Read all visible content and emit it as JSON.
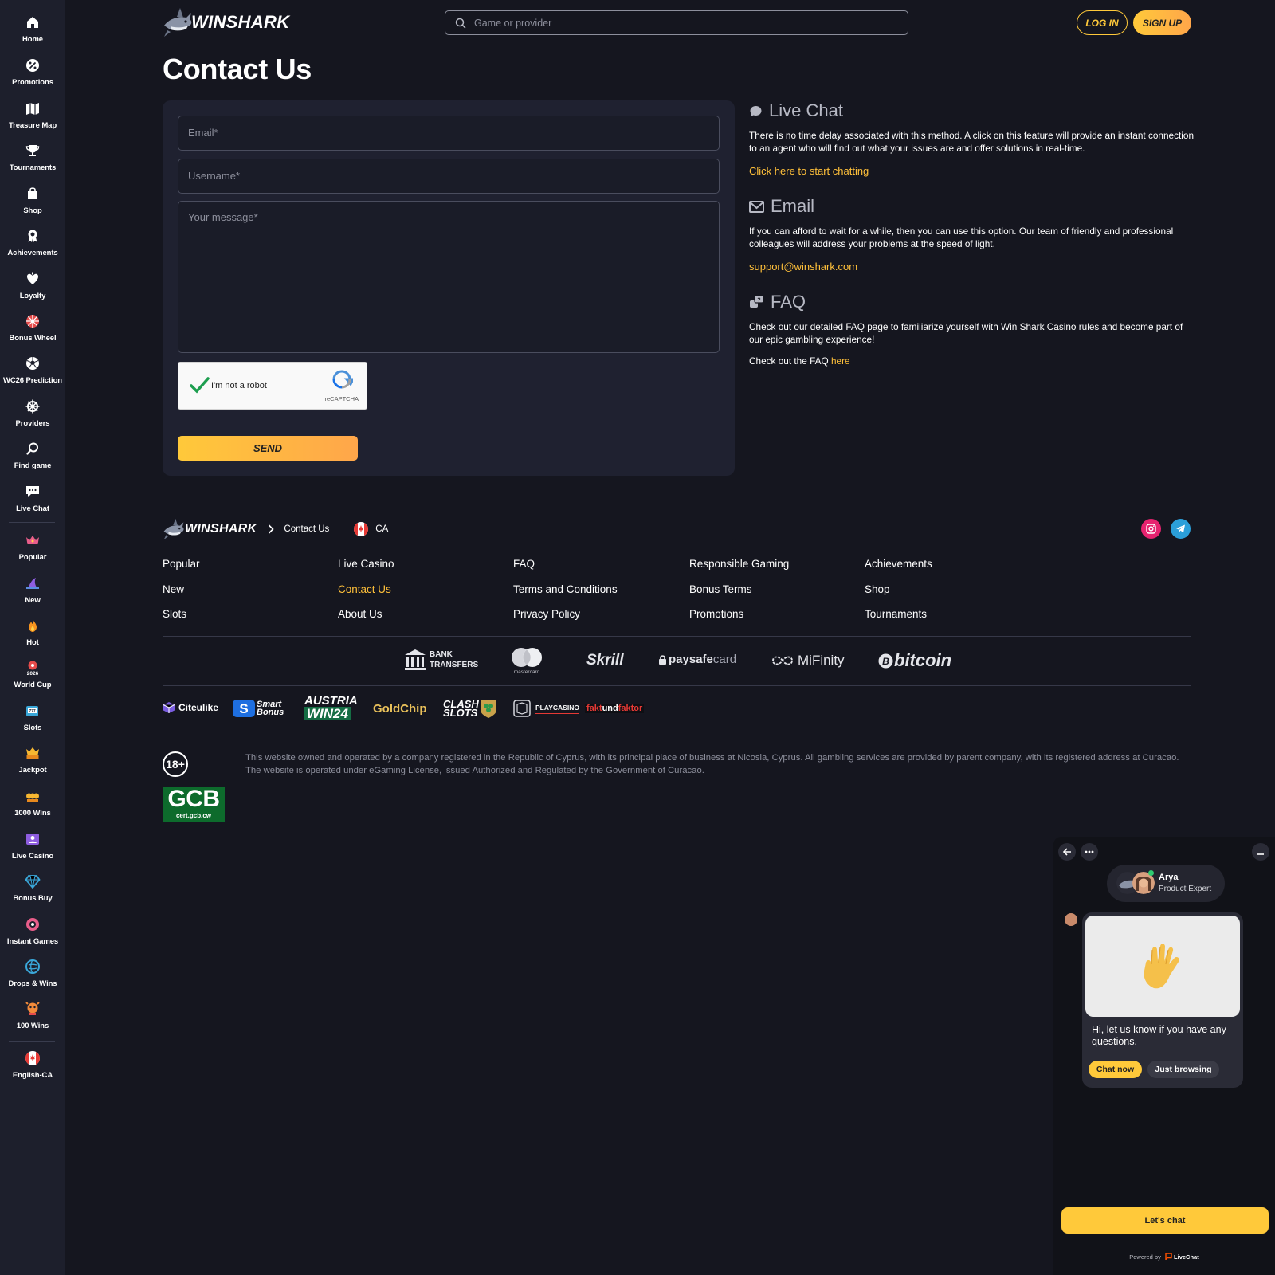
{
  "brand": {
    "name": "WINSHARK",
    "accent": "#ffc93a",
    "background": "#15161f",
    "sidebar_bg": "#1d1f2c"
  },
  "sidebar": {
    "items": [
      {
        "label": "Home",
        "icon": "home-icon"
      },
      {
        "label": "Promotions",
        "icon": "promotions-icon"
      },
      {
        "label": "Treasure Map",
        "icon": "map-icon"
      },
      {
        "label": "Tournaments",
        "icon": "trophy-icon"
      },
      {
        "label": "Shop",
        "icon": "shopping-bag-icon"
      },
      {
        "label": "Achievements",
        "icon": "medal-icon"
      },
      {
        "label": "Loyalty",
        "icon": "loyalty-icon"
      },
      {
        "label": "Bonus Wheel",
        "icon": "wheel-icon"
      },
      {
        "label": "WC26 Prediction",
        "icon": "soccer-ball-icon"
      },
      {
        "label": "Providers",
        "icon": "providers-icon"
      },
      {
        "label": "Find game",
        "icon": "search-icon"
      },
      {
        "label": "Live Chat",
        "icon": "chat-icon"
      }
    ],
    "categories": [
      {
        "label": "Popular",
        "icon": "crown-icon"
      },
      {
        "label": "New",
        "icon": "shark-fin-icon"
      },
      {
        "label": "Hot",
        "icon": "flame-icon"
      },
      {
        "label": "World Cup",
        "icon": "world-cup-icon"
      },
      {
        "label": "Slots",
        "icon": "slot-machine-icon"
      },
      {
        "label": "Jackpot",
        "icon": "jackpot-icon"
      },
      {
        "label": "1000 Wins",
        "icon": "wins-icon"
      },
      {
        "label": "Live Casino",
        "icon": "live-casino-icon"
      },
      {
        "label": "Bonus Buy",
        "icon": "diamond-icon"
      },
      {
        "label": "Instant Games",
        "icon": "instant-games-icon"
      },
      {
        "label": "Drops & Wins",
        "icon": "drops-wins-icon"
      },
      {
        "label": "100 Wins",
        "icon": "hundred-wins-icon"
      }
    ],
    "language": {
      "label": "English-CA",
      "icon": "canada-flag-icon"
    }
  },
  "header": {
    "search_placeholder": "Game or provider",
    "login_label": "LOG IN",
    "signup_label": "SIGN UP"
  },
  "page": {
    "title": "Contact Us"
  },
  "form": {
    "email_placeholder": "Email*",
    "username_placeholder": "Username*",
    "message_placeholder": "Your message*",
    "captcha_label": "I'm not a robot",
    "captcha_brand": "reCAPTCHA",
    "send_label": "SEND"
  },
  "info": {
    "live_chat": {
      "title": "Live Chat",
      "text": "There is no time delay associated with this method. A click on this feature will provide an instant connection to an agent who will find out what your issues are and offer solutions in real-time.",
      "link": "Click here to start chatting"
    },
    "email": {
      "title": "Email",
      "text": "If you can afford to wait for a while, then you can use this option. Our team of friendly and professional colleagues will address your problems at the speed of light.",
      "link": "support@winshark.com"
    },
    "faq": {
      "title": "FAQ",
      "text": "Check out our detailed FAQ page to familiarize yourself with Win Shark Casino rules and become part of our epic gambling experience!",
      "note_prefix": "Check out the FAQ",
      "note_link": "here"
    }
  },
  "footer": {
    "breadcrumb": "Contact Us",
    "country": "CA",
    "columns": [
      [
        "Popular",
        "New",
        "Slots"
      ],
      [
        "Live Casino",
        "Contact Us",
        "About Us"
      ],
      [
        "FAQ",
        "Terms and Conditions",
        "Privacy Policy"
      ],
      [
        "Responsible Gaming",
        "Bonus Terms",
        "Promotions"
      ],
      [
        "Achievements",
        "Shop",
        "Tournaments"
      ]
    ],
    "payments": {
      "bank_line1": "BANK",
      "bank_line2": "TRANSFERS",
      "mastercard": "mastercard",
      "skrill": "Skrill",
      "paysafe_a": "paysafe",
      "paysafe_b": "card",
      "mifinity": "MiFinity",
      "bitcoin": "bitcoin"
    },
    "partners": {
      "citeulike": "Citeulike",
      "smart_bonus_a": "Smart",
      "smart_bonus_b": "Bonus",
      "austria_a": "AUSTRIA",
      "austria_b": "WIN24",
      "goldchip": "GoldChip",
      "clash_a": "CLASH",
      "clash_b": "SLOTS",
      "playcasino": "PLAYCASINO",
      "faktor_a": "fakt",
      "faktor_b": "und",
      "faktor_c": "faktor"
    },
    "age_badge": "18+",
    "gcb_big": "GCB",
    "gcb_small": "cert.gcb.cw",
    "legal": "This website owned and operated by a company registered in the Republic of Cyprus, with its principal place of business at Nicosia, Cyprus. All gambling services are provided by parent company, with its registered address at Curacao. The website is operated under eGaming License, issued Authorized and Regulated by the Government of Curacao."
  },
  "chat_widget": {
    "agent_name": "Arya",
    "agent_role": "Product Expert",
    "message": "Hi, let us know if you have any questions.",
    "reply_primary": "Chat now",
    "reply_secondary": "Just browsing",
    "cta": "Let's chat",
    "powered_prefix": "Powered by",
    "powered_brand": "LiveChat"
  }
}
